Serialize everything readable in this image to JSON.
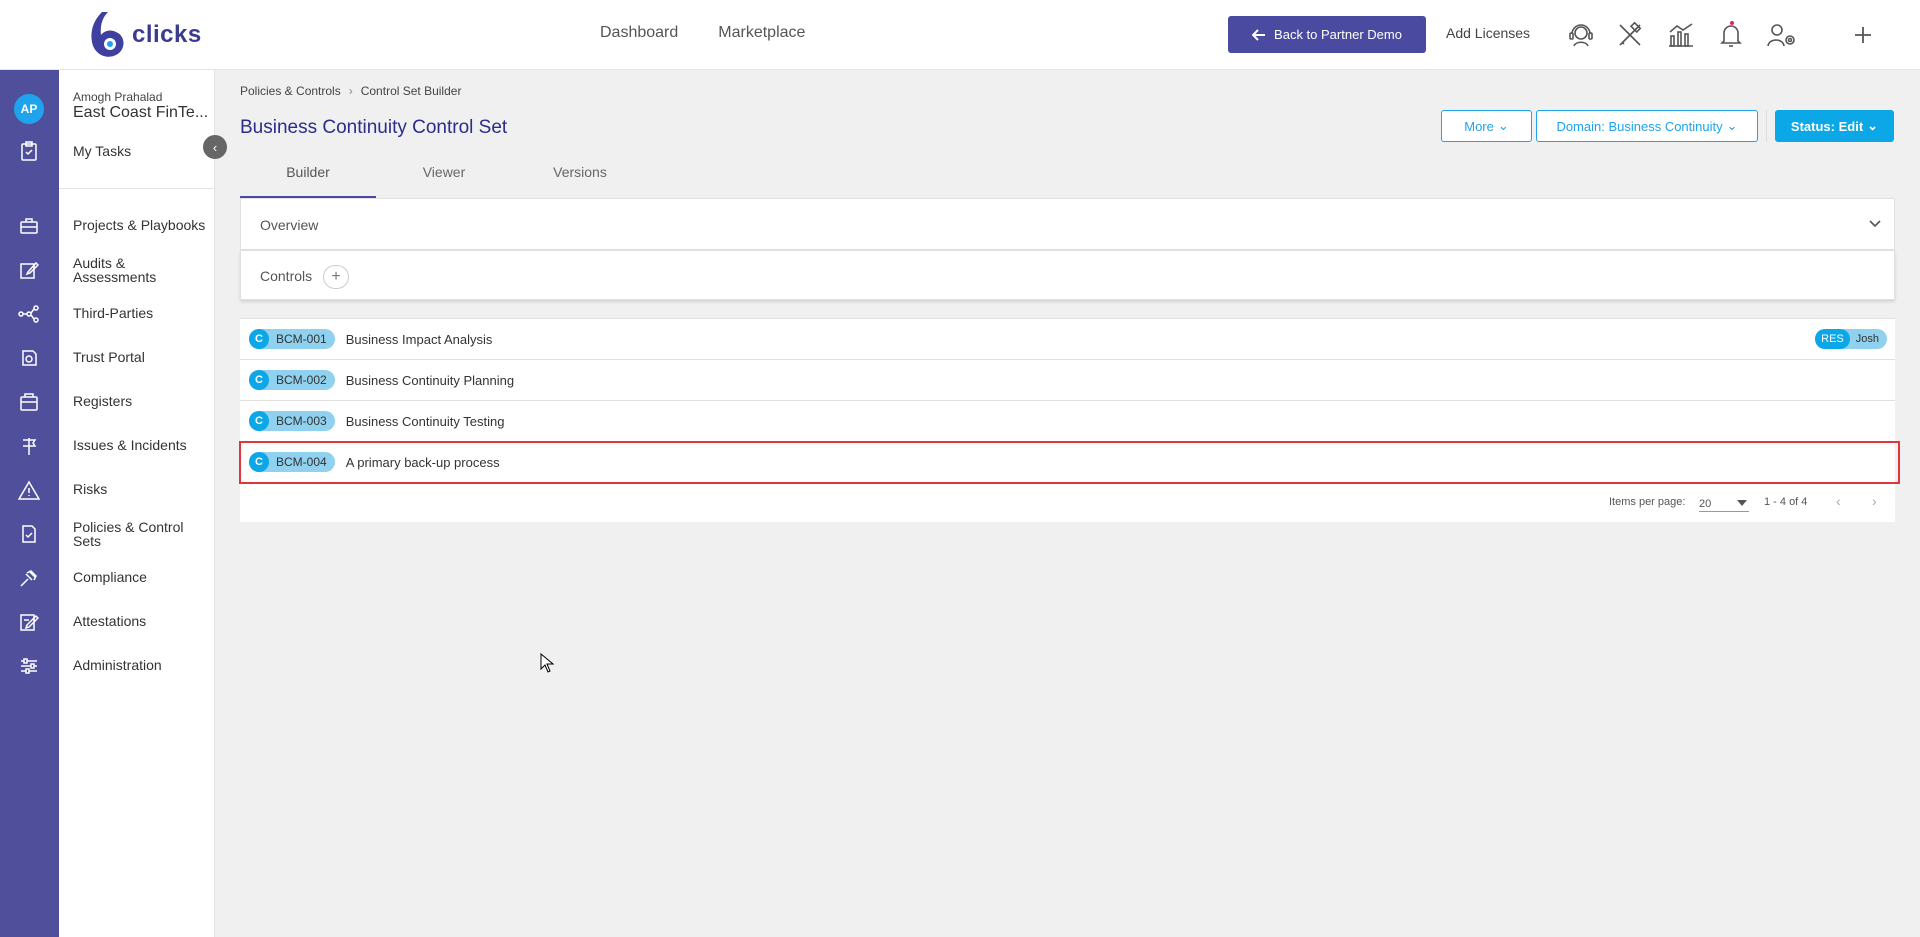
{
  "brand": {
    "name": "clicks",
    "accent": "#4a4aa0",
    "primary_blue": "#0ba7e6"
  },
  "topnav": {
    "dashboard": "Dashboard",
    "marketplace": "Marketplace"
  },
  "header": {
    "back_button": "Back to Partner Demo",
    "add_licenses": "Add Licenses",
    "icons": [
      "support-icon",
      "tools-icon",
      "analytics-icon",
      "bell-icon",
      "user-settings-icon",
      "plus-icon"
    ]
  },
  "user": {
    "initials": "AP",
    "name": "Amogh Prahalad",
    "org": "East Coast FinTe..."
  },
  "sidebar": {
    "items": [
      {
        "label": "My Tasks",
        "icon": "clipboard-check-icon"
      },
      {
        "label": "Projects & Playbooks",
        "icon": "briefcase-icon"
      },
      {
        "label": "Audits & Assessments",
        "icon": "edit-icon"
      },
      {
        "label": "Third-Parties",
        "icon": "network-icon"
      },
      {
        "label": "Trust Portal",
        "icon": "trust-portal-icon"
      },
      {
        "label": "Registers",
        "icon": "register-icon"
      },
      {
        "label": "Issues & Incidents",
        "icon": "signpost-icon"
      },
      {
        "label": "Risks",
        "icon": "warning-icon"
      },
      {
        "label": "Policies & Control Sets",
        "icon": "policy-icon"
      },
      {
        "label": "Compliance",
        "icon": "gavel-icon"
      },
      {
        "label": "Attestations",
        "icon": "attestation-icon"
      },
      {
        "label": "Administration",
        "icon": "sliders-icon"
      }
    ]
  },
  "breadcrumb": {
    "parent": "Policies & Controls",
    "current": "Control Set Builder"
  },
  "page": {
    "title": "Business Continuity Control Set",
    "more_button": "More",
    "domain_button": "Domain: Business Continuity",
    "status_button": "Status: Edit"
  },
  "tabs": [
    {
      "label": "Builder"
    },
    {
      "label": "Viewer"
    },
    {
      "label": "Versions"
    }
  ],
  "sections": {
    "overview": "Overview",
    "controls": "Controls"
  },
  "controls": [
    {
      "type": "C",
      "id": "BCM-001",
      "title": "Business Impact Analysis",
      "assignee_role": "RES",
      "assignee_name": "Josh"
    },
    {
      "type": "C",
      "id": "BCM-002",
      "title": "Business Continuity Planning"
    },
    {
      "type": "C",
      "id": "BCM-003",
      "title": "Business Continuity Testing"
    },
    {
      "type": "C",
      "id": "BCM-004",
      "title": "A primary back-up process",
      "selected": true
    }
  ],
  "pagination": {
    "items_per_page_label": "Items per page:",
    "items_per_page": "20",
    "range": "1 - 4 of 4"
  }
}
